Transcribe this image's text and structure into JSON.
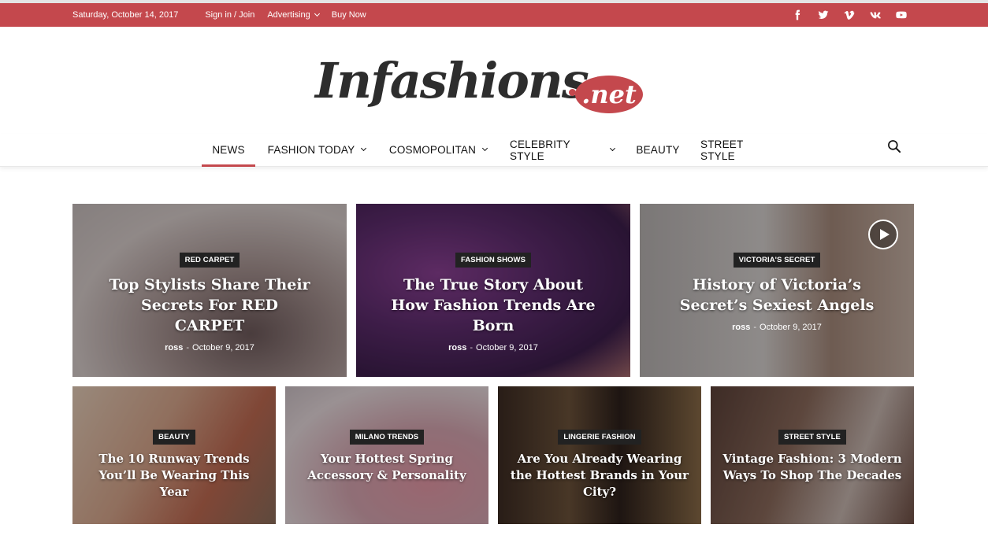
{
  "topbar": {
    "date": "Saturday, October 14, 2017",
    "links": [
      {
        "label": "Sign in / Join",
        "dropdown": false
      },
      {
        "label": "Advertising",
        "dropdown": true
      },
      {
        "label": "Buy Now",
        "dropdown": false
      }
    ],
    "social_icons": [
      "facebook-icon",
      "twitter-icon",
      "vimeo-icon",
      "vk-icon",
      "youtube-icon"
    ]
  },
  "logo": {
    "main": "Infashions",
    "suffix": ".net"
  },
  "nav": {
    "items": [
      {
        "label": "NEWS",
        "active": true,
        "dropdown": false
      },
      {
        "label": "FASHION TODAY",
        "active": false,
        "dropdown": true
      },
      {
        "label": "COSMOPOLITAN",
        "active": false,
        "dropdown": true
      },
      {
        "label": "CELEBRITY STYLE",
        "active": false,
        "dropdown": true
      },
      {
        "label": "BEAUTY",
        "active": false,
        "dropdown": false
      },
      {
        "label": "STREET STYLE",
        "active": false,
        "dropdown": false
      }
    ],
    "search_icon": "search-icon"
  },
  "featured": [
    {
      "category": "RED CARPET",
      "title": "Top Stylists Share Their Secrets For RED CARPET",
      "author": "ross",
      "date": "October 9, 2017",
      "video": false
    },
    {
      "category": "FASHION SHOWS",
      "title": "The True Story About How Fashion Trends Are Born",
      "author": "ross",
      "date": "October 9, 2017",
      "video": false
    },
    {
      "category": "VICTORIA'S SECRET",
      "title": "History of Victoria’s Secret’s Sexiest Angels",
      "author": "ross",
      "date": "October 9, 2017",
      "video": true
    }
  ],
  "secondary": [
    {
      "category": "BEAUTY",
      "title": "The 10 Runway Trends You’ll Be Wearing This Year"
    },
    {
      "category": "MILANO TRENDS",
      "title": "Your Hottest Spring Accessory & Personality"
    },
    {
      "category": "LINGERIE FASHION",
      "title": "Are You Already Wearing the Hottest Brands in Your City?"
    },
    {
      "category": "STREET STYLE",
      "title": "Vintage Fashion: 3 Modern Ways To Shop The Decades"
    }
  ],
  "colors": {
    "accent": "#c4484d",
    "text": "#111111"
  }
}
